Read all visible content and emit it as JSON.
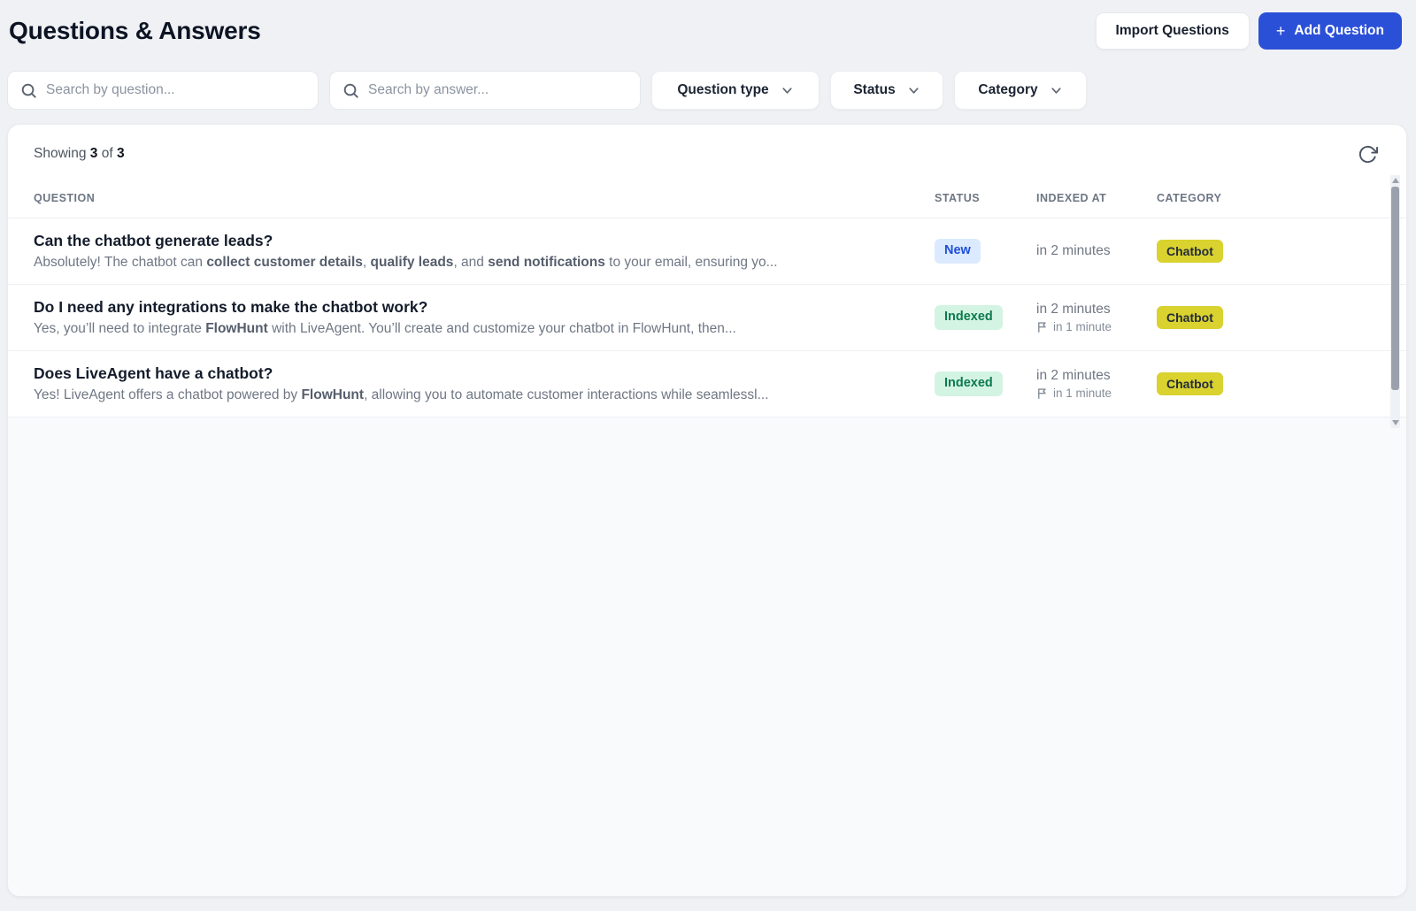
{
  "page": {
    "title": "Questions & Answers"
  },
  "header": {
    "import_button_label": "Import Questions",
    "add_button_plus": "+",
    "add_button_label": "Add Question"
  },
  "filters": {
    "search_question_placeholder": "Search by question...",
    "search_answer_placeholder": "Search by answer...",
    "dropdowns": [
      {
        "key": "question-type",
        "label": "Question type"
      },
      {
        "key": "status",
        "label": "Status"
      },
      {
        "key": "category",
        "label": "Category"
      }
    ]
  },
  "table": {
    "showing": {
      "label": "Showing",
      "count": "3",
      "of_label": "of",
      "total": "3"
    },
    "columns": [
      "QUESTION",
      "STATUS",
      "INDEXED AT",
      "CATEGORY"
    ],
    "rows": [
      {
        "question": "Can the chatbot generate leads?",
        "answer_segments": [
          {
            "text": "Absolutely! The chatbot can ",
            "bold": false
          },
          {
            "text": "collect customer details",
            "bold": true
          },
          {
            "text": ", ",
            "bold": false
          },
          {
            "text": "qualify leads",
            "bold": true
          },
          {
            "text": ", and ",
            "bold": false
          },
          {
            "text": "send notifications",
            "bold": true
          },
          {
            "text": " to your email, ensuring yo...",
            "bold": false
          }
        ],
        "status": {
          "label": "New",
          "variant": "new"
        },
        "indexed_at": "in 2 minutes",
        "indexed_secondary": null,
        "category": "Chatbot"
      },
      {
        "question": "Do I need any integrations to make the chatbot work?",
        "answer_segments": [
          {
            "text": "Yes, you’ll need to integrate ",
            "bold": false
          },
          {
            "text": "FlowHunt",
            "bold": true
          },
          {
            "text": " with LiveAgent. You’ll create and customize your chatbot in FlowHunt, then...",
            "bold": false
          }
        ],
        "status": {
          "label": "Indexed",
          "variant": "indexed"
        },
        "indexed_at": "in 2 minutes",
        "indexed_secondary": "in 1 minute",
        "category": "Chatbot"
      },
      {
        "question": "Does LiveAgent have a chatbot?",
        "answer_segments": [
          {
            "text": "Yes! LiveAgent offers a chatbot powered by ",
            "bold": false
          },
          {
            "text": "FlowHunt",
            "bold": true
          },
          {
            "text": ", allowing you to automate customer interactions while seamlessl...",
            "bold": false
          }
        ],
        "status": {
          "label": "Indexed",
          "variant": "indexed"
        },
        "indexed_at": "in 2 minutes",
        "indexed_secondary": "in 1 minute",
        "category": "Chatbot"
      }
    ]
  },
  "icons": {
    "search": "search-icon",
    "chevron": "chevron-down-icon",
    "refresh": "refresh-icon",
    "flag": "flag-icon"
  },
  "colors": {
    "accent_blue": "#2b50d8",
    "badge_new_bg": "#dbeafe",
    "badge_new_text": "#1d4ed8",
    "badge_indexed_bg": "#d3f4e2",
    "badge_indexed_text": "#0c7a4e",
    "badge_category_bg": "#d9d22f",
    "badge_category_text": "#242c3a"
  }
}
